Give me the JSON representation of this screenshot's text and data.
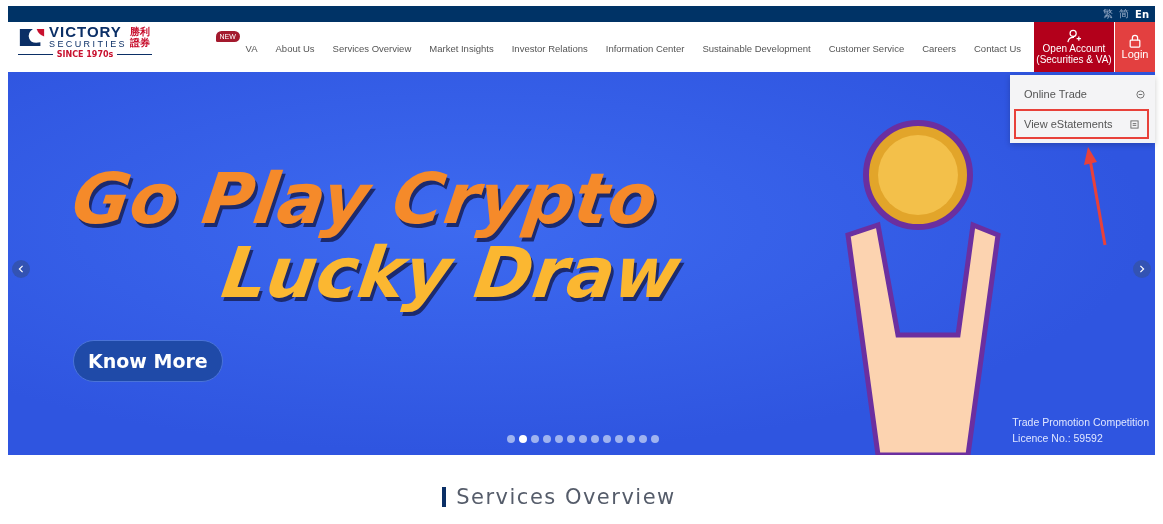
{
  "language_bar": [
    {
      "label": "繁",
      "selected": false
    },
    {
      "label": "简",
      "selected": false
    },
    {
      "label": "En",
      "selected": true
    }
  ],
  "logo": {
    "name": "VICTORY",
    "sub": "SECURITIES",
    "chinese_top": "勝利",
    "chinese_bottom": "證券",
    "since": "SINCE 1970s"
  },
  "nav": [
    {
      "label": "VA",
      "badge": "NEW"
    },
    {
      "label": "About Us"
    },
    {
      "label": "Services Overview"
    },
    {
      "label": "Market Insights"
    },
    {
      "label": "Investor Relations"
    },
    {
      "label": "Information Center"
    },
    {
      "label": "Sustainable Development"
    },
    {
      "label": "Customer Service"
    },
    {
      "label": "Careers"
    },
    {
      "label": "Contact Us"
    }
  ],
  "open_account": {
    "line1": "Open Account",
    "line2": "(Securities & VA)"
  },
  "login": {
    "label": "Login"
  },
  "login_menu": [
    {
      "label": "Online Trade",
      "kind": "trade",
      "highlighted": false
    },
    {
      "label": "View eStatements",
      "kind": "statement",
      "highlighted": true
    }
  ],
  "banner": {
    "headline_1": "Go Play Crypto",
    "headline_2": "Lucky Draw",
    "button": "Know More",
    "licence_1": "Trade Promotion Competition",
    "licence_2": "Licence No.: 59592",
    "dots": [
      {
        "selected": false
      },
      {
        "selected": true
      },
      {
        "selected": false
      },
      {
        "selected": false
      },
      {
        "selected": false
      },
      {
        "selected": false
      },
      {
        "selected": false
      },
      {
        "selected": false
      },
      {
        "selected": false
      },
      {
        "selected": false
      },
      {
        "selected": false
      },
      {
        "selected": false
      },
      {
        "selected": false
      }
    ]
  },
  "section_title": "Services Overview"
}
